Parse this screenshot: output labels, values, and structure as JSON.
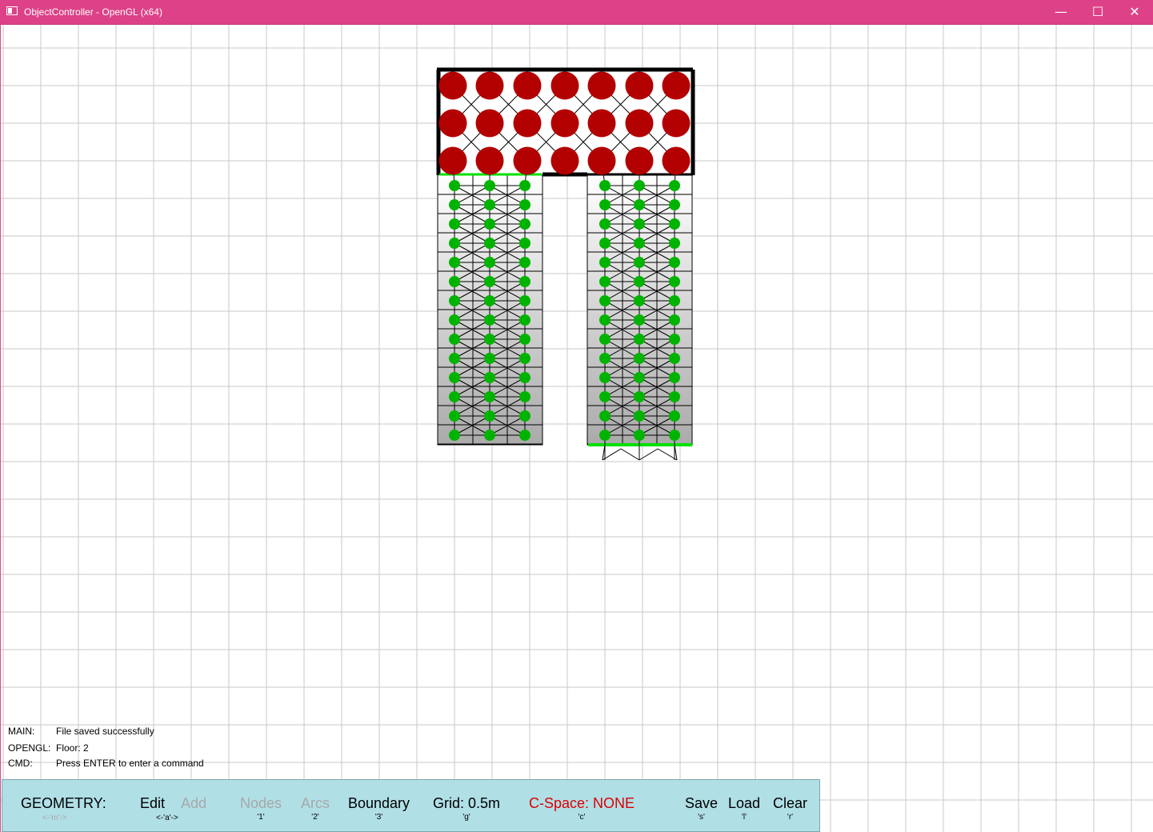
{
  "window": {
    "title": "ObjectController - OpenGL (x64)",
    "minimize_glyph": "—",
    "maximize_glyph": "☐",
    "close_glyph": "✕"
  },
  "colors": {
    "titlebar": "#dd4288",
    "grid": "#c8c8c8",
    "toolbar_bg": "#b0dfe6",
    "node_red": "#b30000",
    "node_green": "#00b300",
    "boundary_green": "#00e000",
    "disabled_text": "#a8a8a8",
    "cspace_text": "#dd0000"
  },
  "console": {
    "lines": [
      {
        "key": "MAIN:",
        "value": "File saved successfully"
      },
      {
        "key": "OPENGL:",
        "value": "Floor: 2"
      },
      {
        "key": "CMD:",
        "value": "Press ENTER to enter a command"
      }
    ]
  },
  "toolbar": {
    "title": "GEOMETRY:",
    "title_key": "<-'m'->",
    "edit": {
      "label": "Edit",
      "state": "active"
    },
    "add": {
      "label": "Add",
      "state": "disabled"
    },
    "mode_key": "<-'a'->",
    "nodes": {
      "label": "Nodes",
      "key": "'1'",
      "state": "disabled"
    },
    "arcs": {
      "label": "Arcs",
      "key": "'2'",
      "state": "disabled"
    },
    "boundary": {
      "label": "Boundary",
      "key": "'3'"
    },
    "grid": {
      "label": "Grid: 0.5m",
      "key": "'g'"
    },
    "cspace": {
      "label": "C-Space: NONE",
      "key": "'c'"
    },
    "save": {
      "label": "Save",
      "key": "'s'"
    },
    "load": {
      "label": "Load",
      "key": "'l'"
    },
    "clear": {
      "label": "Clear",
      "key": "'r'"
    }
  },
  "scene": {
    "grid_size_m": 0.5,
    "floor": 2,
    "top_room": {
      "node_color": "red",
      "rows": 3,
      "cols": 7
    },
    "left_corridor": {
      "node_color": "green",
      "rows": 14,
      "cols": 3
    },
    "right_corridor": {
      "node_color": "green",
      "rows": 14,
      "cols": 3
    }
  }
}
